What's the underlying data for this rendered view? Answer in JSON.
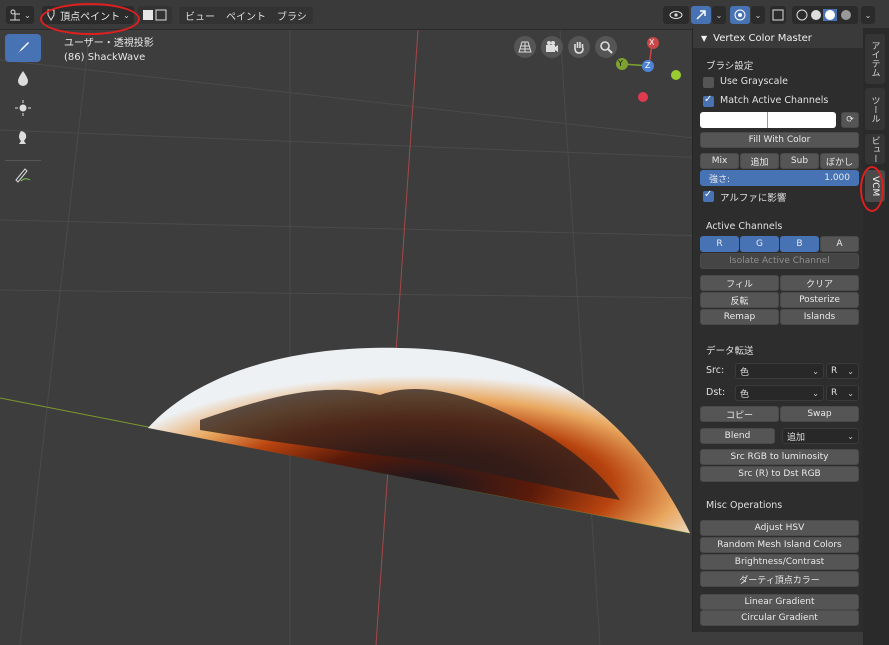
{
  "header": {
    "mode_label": "頂点ペイント",
    "menus": [
      "ビュー",
      "ペイント",
      "ブラシ"
    ]
  },
  "viewport": {
    "view_label": "ユーザー・透視投影",
    "object_label": "(86) ShackWave",
    "gizmo_axes": {
      "x": "X",
      "y": "Y",
      "z": "Z"
    }
  },
  "panel": {
    "title": "Vertex Color Master",
    "brush_section": "ブラシ設定",
    "use_grayscale": "Use Grayscale",
    "match_active": "Match Active Channels",
    "fill_with_color": "Fill With Color",
    "blend_modes": [
      "Mix",
      "追加",
      "Sub",
      "ぼかし"
    ],
    "strength_label": "強さ:",
    "strength_value": "1.000",
    "alpha_affect": "アルファに影響",
    "active_channels_title": "Active Channels",
    "channels": [
      "R",
      "G",
      "B",
      "A"
    ],
    "isolate_label": "Isolate Active Channel",
    "ops": {
      "fill": "フィル",
      "clear": "クリア",
      "invert": "反転",
      "posterize": "Posterize",
      "remap": "Remap",
      "islands": "Islands"
    },
    "data_transfer_title": "データ転送",
    "src_label": "Src:",
    "dst_label": "Dst:",
    "src_value": "色",
    "src_channel": "R",
    "dst_value": "色",
    "dst_channel": "R",
    "copy": "コピー",
    "swap": "Swap",
    "blend": "Blend",
    "blend_mode": "追加",
    "src_rgb_lum": "Src RGB to luminosity",
    "src_r_dst_rgb": "Src (R) to Dst RGB",
    "misc_title": "Misc Operations",
    "adjust_hsv": "Adjust HSV",
    "random_mesh": "Random Mesh Island Colors",
    "brightness": "Brightness/Contrast",
    "dirty": "ダーティ頂点カラー",
    "linear_grad": "Linear Gradient",
    "circular_grad": "Circular Gradient"
  },
  "tabs": [
    "アイテム",
    "ツール",
    "ビュー",
    "VCM"
  ],
  "colors": {
    "accent": "#4772b3",
    "annotation": "#e01f1f"
  }
}
